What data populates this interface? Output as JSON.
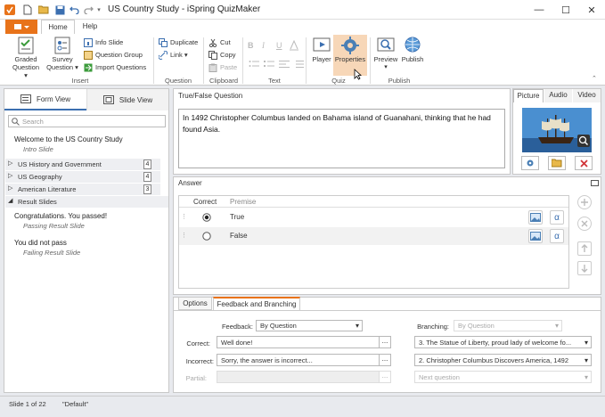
{
  "window": {
    "title": "US Country Study - iSpring QuizMaker",
    "minimize": "—",
    "maximize": "☐",
    "close": "✕"
  },
  "tabs": {
    "file": "",
    "home": "Home",
    "help": "Help"
  },
  "ribbon": {
    "graded": "Graded\nQuestion ▾",
    "survey": "Survey\nQuestion ▾",
    "info_slide": "Info Slide",
    "question_group": "Question Group",
    "import_questions": "Import Questions",
    "insert_label": "Insert",
    "duplicate": "Duplicate",
    "link": "Link ▾",
    "question_label": "Question",
    "cut": "Cut",
    "copy": "Copy",
    "paste": "Paste",
    "clipboard_label": "Clipboard",
    "text_label": "Text",
    "player": "Player",
    "properties": "Properties",
    "quiz_label": "Quiz",
    "preview": "Preview",
    "publish": "Publish",
    "publish_label": "Publish"
  },
  "left": {
    "form_view": "Form View",
    "slide_view": "Slide View",
    "search_placeholder": "Search",
    "intro_title": "Welcome to the US Country Study",
    "intro_sub": "Intro Slide",
    "groups": [
      {
        "label": "US History and Government",
        "count": "4"
      },
      {
        "label": "US Geography",
        "count": "4"
      },
      {
        "label": "American Literature",
        "count": "3"
      },
      {
        "label": "Result Slides",
        "count": ""
      }
    ],
    "results": [
      {
        "title": "Congratulations. You passed!",
        "sub": "Passing Result Slide"
      },
      {
        "title": "You did not pass",
        "sub": "Failing Result Slide"
      }
    ]
  },
  "question": {
    "label": "True/False Question",
    "text": "In 1492 Christopher Columbus landed on Bahama island of Guanahani, thinking that he had found Asia."
  },
  "media": {
    "picture": "Picture",
    "audio": "Audio",
    "video": "Video"
  },
  "answer": {
    "label": "Answer",
    "col_correct": "Correct",
    "col_premise": "Premise",
    "rows": [
      {
        "text": "True",
        "selected": true
      },
      {
        "text": "False",
        "selected": false
      }
    ],
    "alpha": "α"
  },
  "bottom_tabs": {
    "options": "Options",
    "feedback": "Feedback and Branching"
  },
  "feedback": {
    "feedback_label": "Feedback:",
    "feedback_value": "By Question",
    "branching_label": "Branching:",
    "branching_value": "By Question",
    "correct_label": "Correct:",
    "correct_value": "Well done!",
    "correct_branch": "3. The Statue of Liberty, proud lady of welcome fo...",
    "incorrect_label": "Incorrect:",
    "incorrect_value": "Sorry, the answer is incorrect...",
    "incorrect_branch": "2. Christopher Columbus Discovers America, 1492",
    "partial_label": "Partial:",
    "partial_value": "",
    "partial_branch": "Next question",
    "ellipsis": "..."
  },
  "status": {
    "slide": "Slide 1 of 22",
    "theme": "\"Default\""
  },
  "colors": {
    "accent": "#e8731a",
    "active_tab": "#f7d7b8",
    "blue_icon": "#4a7fb5",
    "red_icon": "#d13438"
  }
}
